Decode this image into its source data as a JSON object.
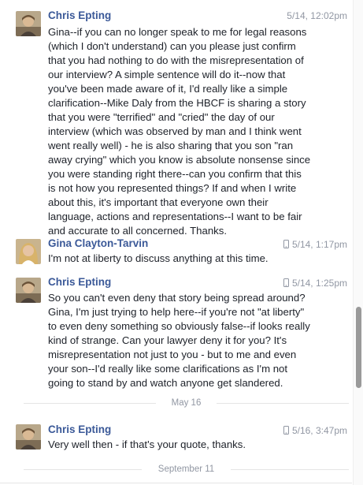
{
  "messages": [
    {
      "sender": "Chris Epting",
      "time": "5/14, 12:02pm",
      "mobile": false,
      "avatar": "chris",
      "text": "Gina--if you can no longer speak to me for legal reasons\n(which I don't understand) can you please just confirm\nthat you had nothing to do with the misrepresentation of\nour interview? A simple sentence will do it--now that\nyou've been made aware of it, I'd really like a simple\nclarification--Mike Daly from the HBCF is sharing a story\nthat you were \"terrified\" and \"cried\" the day of our\ninterview (which was observed by man and I think went\nwent really well) - he is also sharing that you son \"ran\naway crying\" which you know is absolute nonsense since\nyou were standing right there--can you confirm that this\nis not how you represented things? If and when I write\nabout this,  it's important that everyone own their\nlanguage, actions and representations--I want to be fair\nand accurate to all concerned. Thanks."
    },
    {
      "sender": "Gina Clayton-Tarvin",
      "time": "5/14, 1:17pm",
      "mobile": true,
      "avatar": "gina",
      "text": "I'm not at liberty to discuss anything at this time."
    },
    {
      "sender": "Chris Epting",
      "time": "5/14, 1:25pm",
      "mobile": true,
      "avatar": "chris",
      "text": "So you can't even deny that story being spread around?\nGina, I'm just trying to help here--if you're not \"at liberty\"\nto even deny something so obviously false--if looks really\nkind of strange. Can your lawyer deny it for you? It's\nmisrepresentation not just to you - but to me and even\nyour son--I'd really like some clarifications as I'm not\ngoing to stand by and watch anyone get slandered."
    },
    {
      "sender": "Chris Epting",
      "time": "5/16, 3:47pm",
      "mobile": true,
      "avatar": "chris",
      "text": "Very well then - if that's your quote, thanks."
    }
  ],
  "dividers": [
    "May 16",
    "September 11"
  ],
  "icons": {
    "mobile": "mobile-phone-icon"
  },
  "colors": {
    "sender": "#3b5998",
    "meta": "#9197a3",
    "text": "#1d2129"
  }
}
